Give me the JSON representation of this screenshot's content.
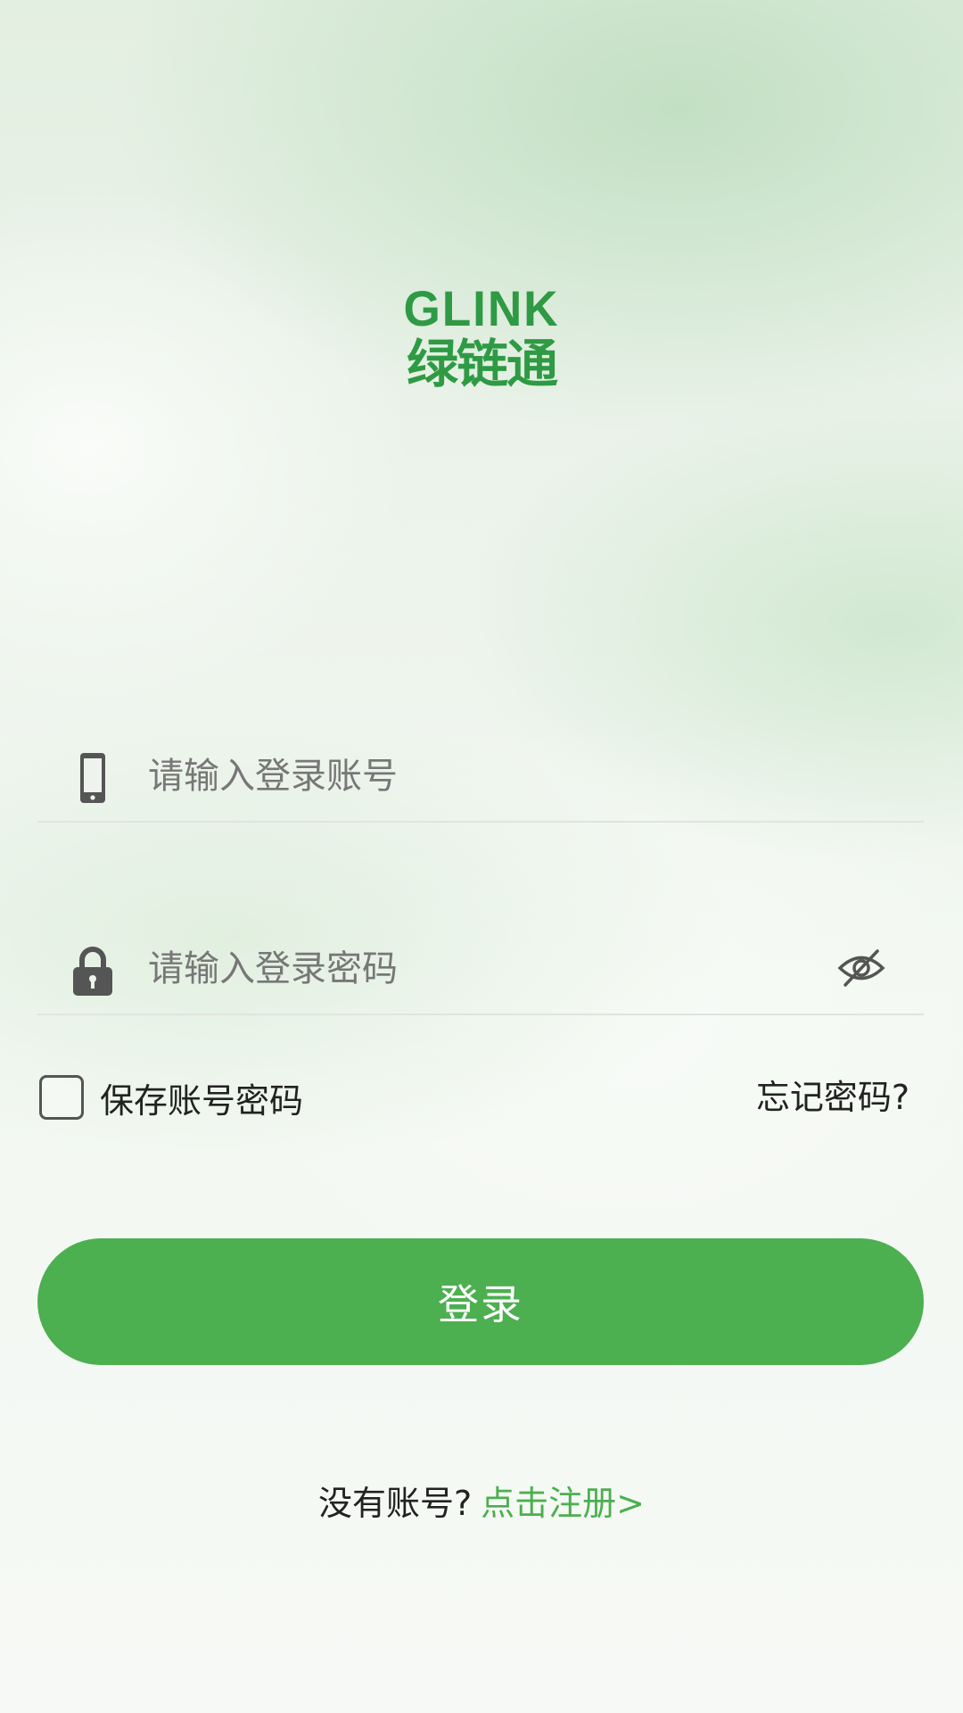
{
  "logo": {
    "latin": "GLINK",
    "chinese": "绿链通"
  },
  "account_field": {
    "placeholder": "请输入登录账号",
    "value": "",
    "icon": "phone-icon"
  },
  "password_field": {
    "placeholder": "请输入登录密码",
    "value": "",
    "icon": "lock-icon",
    "toggle_icon": "eye-off-icon"
  },
  "options": {
    "remember_label": "保存账号密码",
    "remember_checked": false,
    "forgot_label": "忘记密码?"
  },
  "login_button": {
    "label": "登录"
  },
  "register": {
    "prompt": "没有账号?",
    "link": "点击注册>"
  },
  "colors": {
    "brand_green": "#4caf50",
    "logo_green": "#2f9a44",
    "icon_gray": "#555555"
  }
}
